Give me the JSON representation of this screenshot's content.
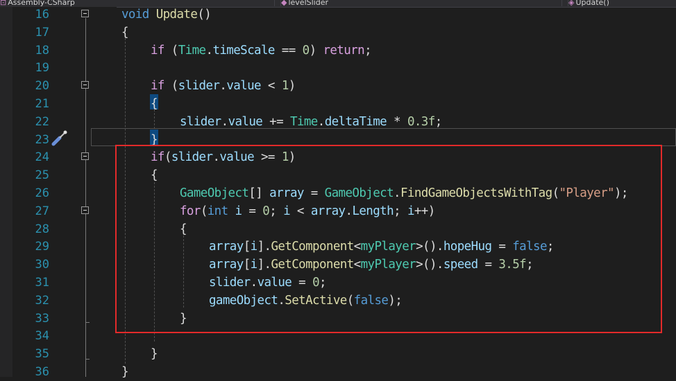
{
  "tabs": [
    {
      "label": "Assembly-CSharp",
      "icon": "cs-project-icon"
    },
    {
      "label": "levelSlider",
      "icon": "class-icon"
    },
    {
      "label": "Update()",
      "icon": "method-icon"
    }
  ],
  "lines": [
    {
      "n": "16",
      "fold": true,
      "indent": 0,
      "tokens": [
        [
          "kw",
          "void"
        ],
        [
          "p",
          " "
        ],
        [
          "fn",
          "Update"
        ],
        [
          "p",
          "()"
        ]
      ]
    },
    {
      "n": "17",
      "fold": false,
      "indent": 0,
      "tokens": [
        [
          "p",
          "{"
        ]
      ]
    },
    {
      "n": "18",
      "fold": false,
      "indent": 1,
      "tokens": [
        [
          "ctl",
          "if"
        ],
        [
          "p",
          " ("
        ],
        [
          "ty",
          "Time"
        ],
        [
          "p",
          "."
        ],
        [
          "id",
          "timeScale"
        ],
        [
          "p",
          " == "
        ],
        [
          "nu",
          "0"
        ],
        [
          "p",
          ") "
        ],
        [
          "ctl",
          "return"
        ],
        [
          "p",
          ";"
        ]
      ]
    },
    {
      "n": "19",
      "fold": false,
      "indent": 0,
      "tokens": []
    },
    {
      "n": "20",
      "fold": true,
      "indent": 1,
      "tokens": [
        [
          "ctl",
          "if"
        ],
        [
          "p",
          " ("
        ],
        [
          "id",
          "slider"
        ],
        [
          "p",
          "."
        ],
        [
          "id",
          "value"
        ],
        [
          "p",
          " < "
        ],
        [
          "nu",
          "1"
        ],
        [
          "p",
          ")"
        ]
      ]
    },
    {
      "n": "21",
      "fold": false,
      "indent": 1,
      "tokens": [
        [
          "p",
          "{"
        ]
      ]
    },
    {
      "n": "22",
      "fold": false,
      "indent": 2,
      "tokens": [
        [
          "id",
          "slider"
        ],
        [
          "p",
          "."
        ],
        [
          "id",
          "value"
        ],
        [
          "p",
          " += "
        ],
        [
          "ty",
          "Time"
        ],
        [
          "p",
          "."
        ],
        [
          "id",
          "deltaTime"
        ],
        [
          "p",
          " * "
        ],
        [
          "nu",
          "0.3f"
        ],
        [
          "p",
          ";"
        ]
      ]
    },
    {
      "n": "23",
      "fold": false,
      "indent": 1,
      "tokens": [
        [
          "p",
          "}"
        ]
      ]
    },
    {
      "n": "24",
      "fold": true,
      "indent": 1,
      "tokens": [
        [
          "ctl",
          "if"
        ],
        [
          "p",
          "("
        ],
        [
          "id",
          "slider"
        ],
        [
          "p",
          "."
        ],
        [
          "id",
          "value"
        ],
        [
          "p",
          " >= "
        ],
        [
          "nu",
          "1"
        ],
        [
          "p",
          ")"
        ]
      ]
    },
    {
      "n": "25",
      "fold": false,
      "indent": 1,
      "tokens": [
        [
          "p",
          "{"
        ]
      ]
    },
    {
      "n": "26",
      "fold": false,
      "indent": 2,
      "tokens": [
        [
          "ty",
          "GameObject"
        ],
        [
          "p",
          "[] "
        ],
        [
          "id",
          "array"
        ],
        [
          "p",
          " = "
        ],
        [
          "ty",
          "GameObject"
        ],
        [
          "p",
          "."
        ],
        [
          "fn",
          "FindGameObjectsWithTag"
        ],
        [
          "p",
          "("
        ],
        [
          "st",
          "\"Player\""
        ],
        [
          "p",
          ");"
        ]
      ]
    },
    {
      "n": "27",
      "fold": true,
      "indent": 2,
      "tokens": [
        [
          "ctl",
          "for"
        ],
        [
          "p",
          "("
        ],
        [
          "kw",
          "int"
        ],
        [
          "p",
          " "
        ],
        [
          "id",
          "i"
        ],
        [
          "p",
          " = "
        ],
        [
          "nu",
          "0"
        ],
        [
          "p",
          "; "
        ],
        [
          "id",
          "i"
        ],
        [
          "p",
          " < "
        ],
        [
          "id",
          "array"
        ],
        [
          "p",
          "."
        ],
        [
          "id",
          "Length"
        ],
        [
          "p",
          "; "
        ],
        [
          "id",
          "i"
        ],
        [
          "p",
          "++)"
        ]
      ]
    },
    {
      "n": "28",
      "fold": false,
      "indent": 2,
      "tokens": [
        [
          "p",
          "{"
        ]
      ]
    },
    {
      "n": "29",
      "fold": false,
      "indent": 3,
      "tokens": [
        [
          "id",
          "array"
        ],
        [
          "p",
          "["
        ],
        [
          "id",
          "i"
        ],
        [
          "p",
          "]."
        ],
        [
          "fn",
          "GetComponent"
        ],
        [
          "p",
          "<"
        ],
        [
          "ty",
          "myPlayer"
        ],
        [
          "p",
          ">()."
        ],
        [
          "id",
          "hopeHug"
        ],
        [
          "p",
          " = "
        ],
        [
          "kw",
          "false"
        ],
        [
          "p",
          ";"
        ]
      ]
    },
    {
      "n": "30",
      "fold": false,
      "indent": 3,
      "tokens": [
        [
          "id",
          "array"
        ],
        [
          "p",
          "["
        ],
        [
          "id",
          "i"
        ],
        [
          "p",
          "]."
        ],
        [
          "fn",
          "GetComponent"
        ],
        [
          "p",
          "<"
        ],
        [
          "ty",
          "myPlayer"
        ],
        [
          "p",
          ">()."
        ],
        [
          "id",
          "speed"
        ],
        [
          "p",
          " = "
        ],
        [
          "nu",
          "3.5f"
        ],
        [
          "p",
          ";"
        ]
      ]
    },
    {
      "n": "31",
      "fold": false,
      "indent": 3,
      "tokens": [
        [
          "id",
          "slider"
        ],
        [
          "p",
          "."
        ],
        [
          "id",
          "value"
        ],
        [
          "p",
          " = "
        ],
        [
          "nu",
          "0"
        ],
        [
          "p",
          ";"
        ]
      ]
    },
    {
      "n": "32",
      "fold": false,
      "indent": 3,
      "tokens": [
        [
          "id",
          "gameObject"
        ],
        [
          "p",
          "."
        ],
        [
          "fn",
          "SetActive"
        ],
        [
          "p",
          "("
        ],
        [
          "kw",
          "false"
        ],
        [
          "p",
          ");"
        ]
      ]
    },
    {
      "n": "33",
      "fold": false,
      "indent": 2,
      "tokens": [
        [
          "p",
          "}"
        ]
      ]
    },
    {
      "n": "34",
      "fold": false,
      "indent": 0,
      "tokens": []
    },
    {
      "n": "35",
      "fold": false,
      "indent": 1,
      "tokens": [
        [
          "p",
          "}"
        ]
      ]
    },
    {
      "n": "36",
      "fold": false,
      "indent": 0,
      "tokens": [
        [
          "p",
          "}"
        ]
      ]
    }
  ],
  "colors": {
    "background": "#1e1e1e",
    "line_number": "#2b91af",
    "keyword": "#569cd6",
    "control_keyword": "#d8a0df",
    "type": "#4ec9b0",
    "method": "#dcdcaa",
    "string": "#d69d85",
    "number": "#b5cea8",
    "identifier": "#9cdcfe",
    "highlight_box": "#e32a2a"
  },
  "gutter_icons": [
    {
      "line": "23",
      "icon": "quick-action-screwdriver-icon"
    }
  ],
  "current_line": "23",
  "highlighted_range": {
    "from": "24",
    "to": "33"
  }
}
